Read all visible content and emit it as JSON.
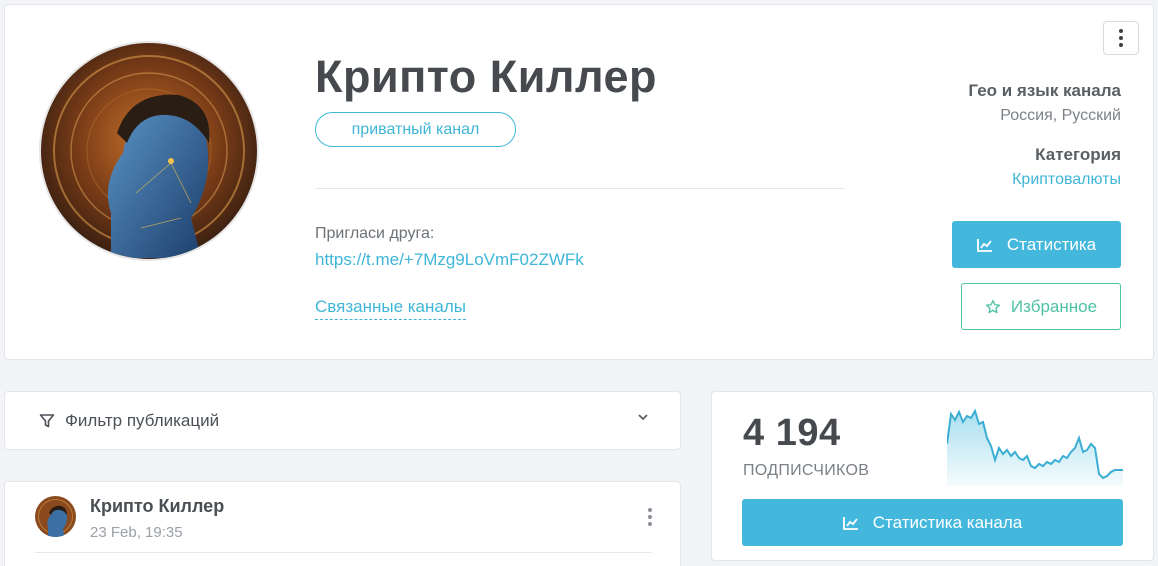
{
  "channel": {
    "title": "Крипто Киллер",
    "type_badge": "приватный канал",
    "invite_label": "Пригласи друга:",
    "invite_link": "https://t.me/+7Mzg9LoVmF02ZWFk",
    "related_link": "Связанные каналы"
  },
  "meta": {
    "geo_label": "Гео и язык канала",
    "geo_value": "Россия, Русский",
    "category_label": "Категория",
    "category_value": "Криптовалюты"
  },
  "actions": {
    "stats_label": "Статистика",
    "favorite_label": "Избранное"
  },
  "filter": {
    "label": "Фильтр публикаций"
  },
  "post": {
    "author": "Крипто Киллер",
    "time": "23 Feb, 19:35"
  },
  "subscribers": {
    "count": "4 194",
    "label": "подписчиков",
    "button_label": "Статистика канала"
  },
  "colors": {
    "accent": "#44b8dc",
    "favorite": "#4ec2a5",
    "text_dark": "#464a4f",
    "muted": "#7c8288"
  },
  "icons": {
    "menu": "vertical-dots-icon",
    "chart": "chart-icon",
    "star": "star-outline-icon",
    "filter": "funnel-icon",
    "chevron": "chevron-down-icon"
  }
}
